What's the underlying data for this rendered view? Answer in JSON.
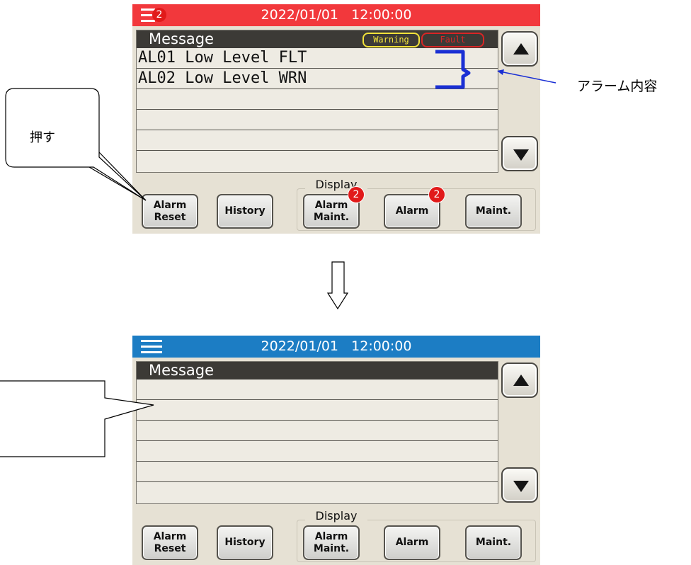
{
  "top_screen": {
    "titlebar": {
      "color": "#f2383c",
      "datetime": "2022/01/01   12:00:00",
      "menu_badge": "2"
    },
    "message_panel": {
      "header": "Message",
      "warning_label": "Warning",
      "fault_label": "Fault",
      "rows": [
        "AL01 Low Level FLT",
        "AL02 Low Level WRN",
        "",
        "",
        "",
        ""
      ]
    },
    "buttons": {
      "alarm_reset": "Alarm\nReset",
      "history": "History",
      "display_label": "Display",
      "alarm_maint": "Alarm\nMaint.",
      "alarm_maint_badge": "2",
      "alarm": "Alarm",
      "alarm_badge": "2",
      "maint": "Maint."
    }
  },
  "bottom_screen": {
    "titlebar": {
      "color": "#1c7dc4",
      "datetime": "2022/01/01   12:00:00"
    },
    "message_panel": {
      "header": "Message",
      "rows": [
        "",
        "",
        "",
        "",
        "",
        "",
        ""
      ]
    },
    "buttons": {
      "alarm_reset": "Alarm\nReset",
      "history": "History",
      "display_label": "Display",
      "alarm_maint": "Alarm\nMaint.",
      "alarm": "Alarm",
      "maint": "Maint."
    }
  },
  "annotations": {
    "push_callout": "押す",
    "alarm_content_label": "アラーム内容",
    "bracket_color": "#1a2fd4"
  }
}
